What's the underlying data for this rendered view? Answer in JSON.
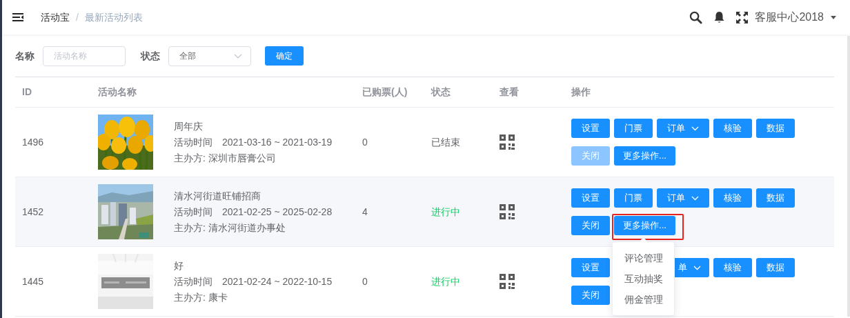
{
  "header": {
    "breadcrumb": [
      "活动宝",
      "最新活动列表"
    ],
    "separator": "/",
    "user": "客服中心2018"
  },
  "filters": [
    {
      "kind": "input",
      "label": "名称",
      "placeholder": "活动名称"
    },
    {
      "kind": "select",
      "label": "状态",
      "value": "全部"
    }
  ],
  "submit": "确定",
  "table": {
    "columns": [
      "ID",
      "活动名称",
      "已购票(人)",
      "状态",
      "查看",
      "操作"
    ],
    "rows": [
      {
        "id": "1496",
        "title": "周年庆",
        "time_label": "活动时间",
        "time": "2021-03-16 ~ 2021-03-19",
        "organizer": "主办方: 深圳市唇膏公司",
        "tickets": "0",
        "status": {
          "text": "已结束",
          "kind": "ended"
        },
        "hovered": false,
        "picture": {
          "kind": "picture"
        },
        "actions": [
          {
            "kind": "button",
            "label": "设置",
            "disabled": false,
            "highlighted": false
          },
          {
            "kind": "button",
            "label": "门票",
            "disabled": false,
            "highlighted": false
          },
          {
            "kind": "dropdown",
            "label": "订单",
            "disabled": false,
            "highlighted": false
          },
          {
            "kind": "button",
            "label": "核验",
            "disabled": false,
            "highlighted": false
          },
          {
            "kind": "button",
            "label": "数据",
            "disabled": false,
            "highlighted": false
          },
          {
            "kind": "button",
            "label": "关闭",
            "disabled": true,
            "highlighted": false
          },
          {
            "kind": "more",
            "label": "更多操作...",
            "disabled": false,
            "highlighted": false
          }
        ]
      },
      {
        "id": "1452",
        "title": "清水河街道旺铺招商",
        "time_label": "活动时间",
        "time": "2021-02-25 ~ 2025-02-28",
        "organizer": "主办方: 清水河街道办事处",
        "tickets": "4",
        "status": {
          "text": "进行中",
          "kind": "ongoing"
        },
        "hovered": true,
        "picture": {
          "kind": "picture"
        },
        "actions": [
          {
            "kind": "button",
            "label": "设置",
            "disabled": false,
            "highlighted": false
          },
          {
            "kind": "button",
            "label": "门票",
            "disabled": false,
            "highlighted": false
          },
          {
            "kind": "dropdown",
            "label": "订单",
            "disabled": false,
            "highlighted": false
          },
          {
            "kind": "button",
            "label": "核验",
            "disabled": false,
            "highlighted": false
          },
          {
            "kind": "button",
            "label": "数据",
            "disabled": false,
            "highlighted": false
          },
          {
            "kind": "button",
            "label": "关闭",
            "disabled": false,
            "highlighted": false
          },
          {
            "kind": "more",
            "label": "更多操作...",
            "disabled": false,
            "highlighted": true,
            "menu": [
              "评论管理",
              "互动抽奖",
              "佣金管理"
            ]
          }
        ]
      },
      {
        "id": "1445",
        "title": "好",
        "time_label": "活动时间",
        "time": "2021-02-24 ~ 2022-10-15",
        "organizer": "主办方: 康卡",
        "tickets": "0",
        "status": {
          "text": "进行中",
          "kind": "ongoing"
        },
        "hovered": false,
        "picture": {
          "kind": "picture"
        },
        "actions": [
          {
            "kind": "button",
            "label": "设置",
            "disabled": false,
            "highlighted": false
          },
          {
            "kind": "covered"
          },
          {
            "kind": "dropdown_cut",
            "label": "单",
            "disabled": false,
            "highlighted": false
          },
          {
            "kind": "button",
            "label": "核验",
            "disabled": false,
            "highlighted": false
          },
          {
            "kind": "button",
            "label": "数据",
            "disabled": false,
            "highlighted": false
          },
          {
            "kind": "button",
            "label": "关闭",
            "disabled": false,
            "highlighted": false
          }
        ]
      }
    ]
  }
}
